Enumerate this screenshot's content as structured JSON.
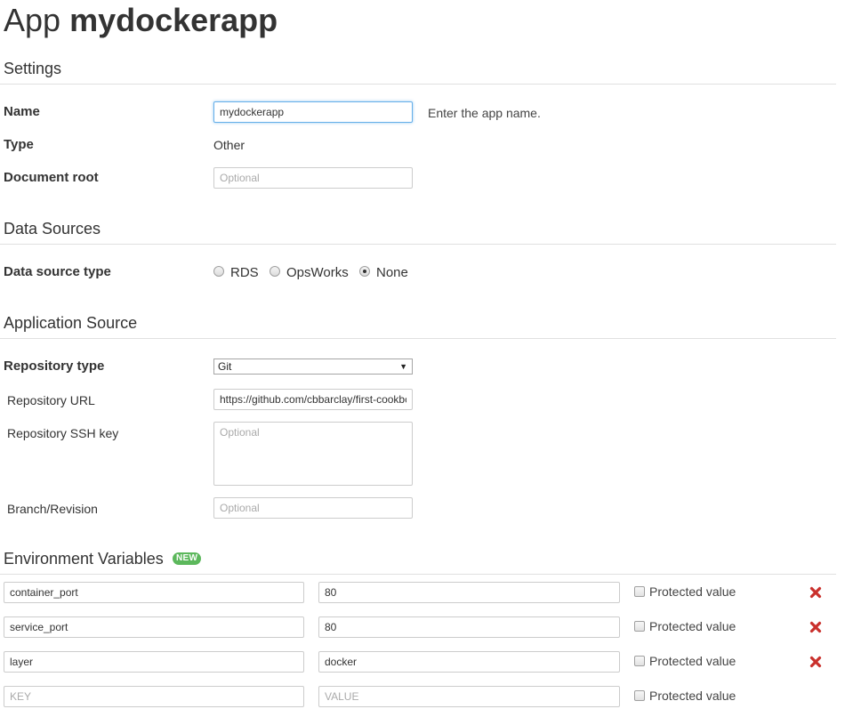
{
  "header": {
    "prefix": "App",
    "app_name": "mydockerapp"
  },
  "settings": {
    "title": "Settings",
    "name": {
      "label": "Name",
      "value": "mydockerapp",
      "help": "Enter the app name."
    },
    "type": {
      "label": "Type",
      "value": "Other"
    },
    "document_root": {
      "label": "Document root",
      "placeholder": "Optional"
    }
  },
  "data_sources": {
    "title": "Data Sources",
    "type_label": "Data source type",
    "options": [
      "RDS",
      "OpsWorks",
      "None"
    ],
    "selected": "None"
  },
  "application_source": {
    "title": "Application Source",
    "repository_type": {
      "label": "Repository type",
      "value": "Git"
    },
    "repository_url": {
      "label": "Repository URL",
      "value": "https://github.com/cbbarclay/first-cookbc"
    },
    "ssh_key": {
      "label": "Repository SSH key",
      "placeholder": "Optional"
    },
    "branch": {
      "label": "Branch/Revision",
      "placeholder": "Optional"
    }
  },
  "environment_variables": {
    "title": "Environment Variables",
    "badge": "NEW",
    "protected_label": "Protected value",
    "key_placeholder": "KEY",
    "value_placeholder": "VALUE",
    "rows": [
      {
        "key": "container_port",
        "value": "80",
        "protected": false
      },
      {
        "key": "service_port",
        "value": "80",
        "protected": false
      },
      {
        "key": "layer",
        "value": "docker",
        "protected": false
      }
    ]
  },
  "colors": {
    "remove_icon": "#c9302c",
    "badge_new": "#5cb85c",
    "focus_border": "#66afe9"
  }
}
